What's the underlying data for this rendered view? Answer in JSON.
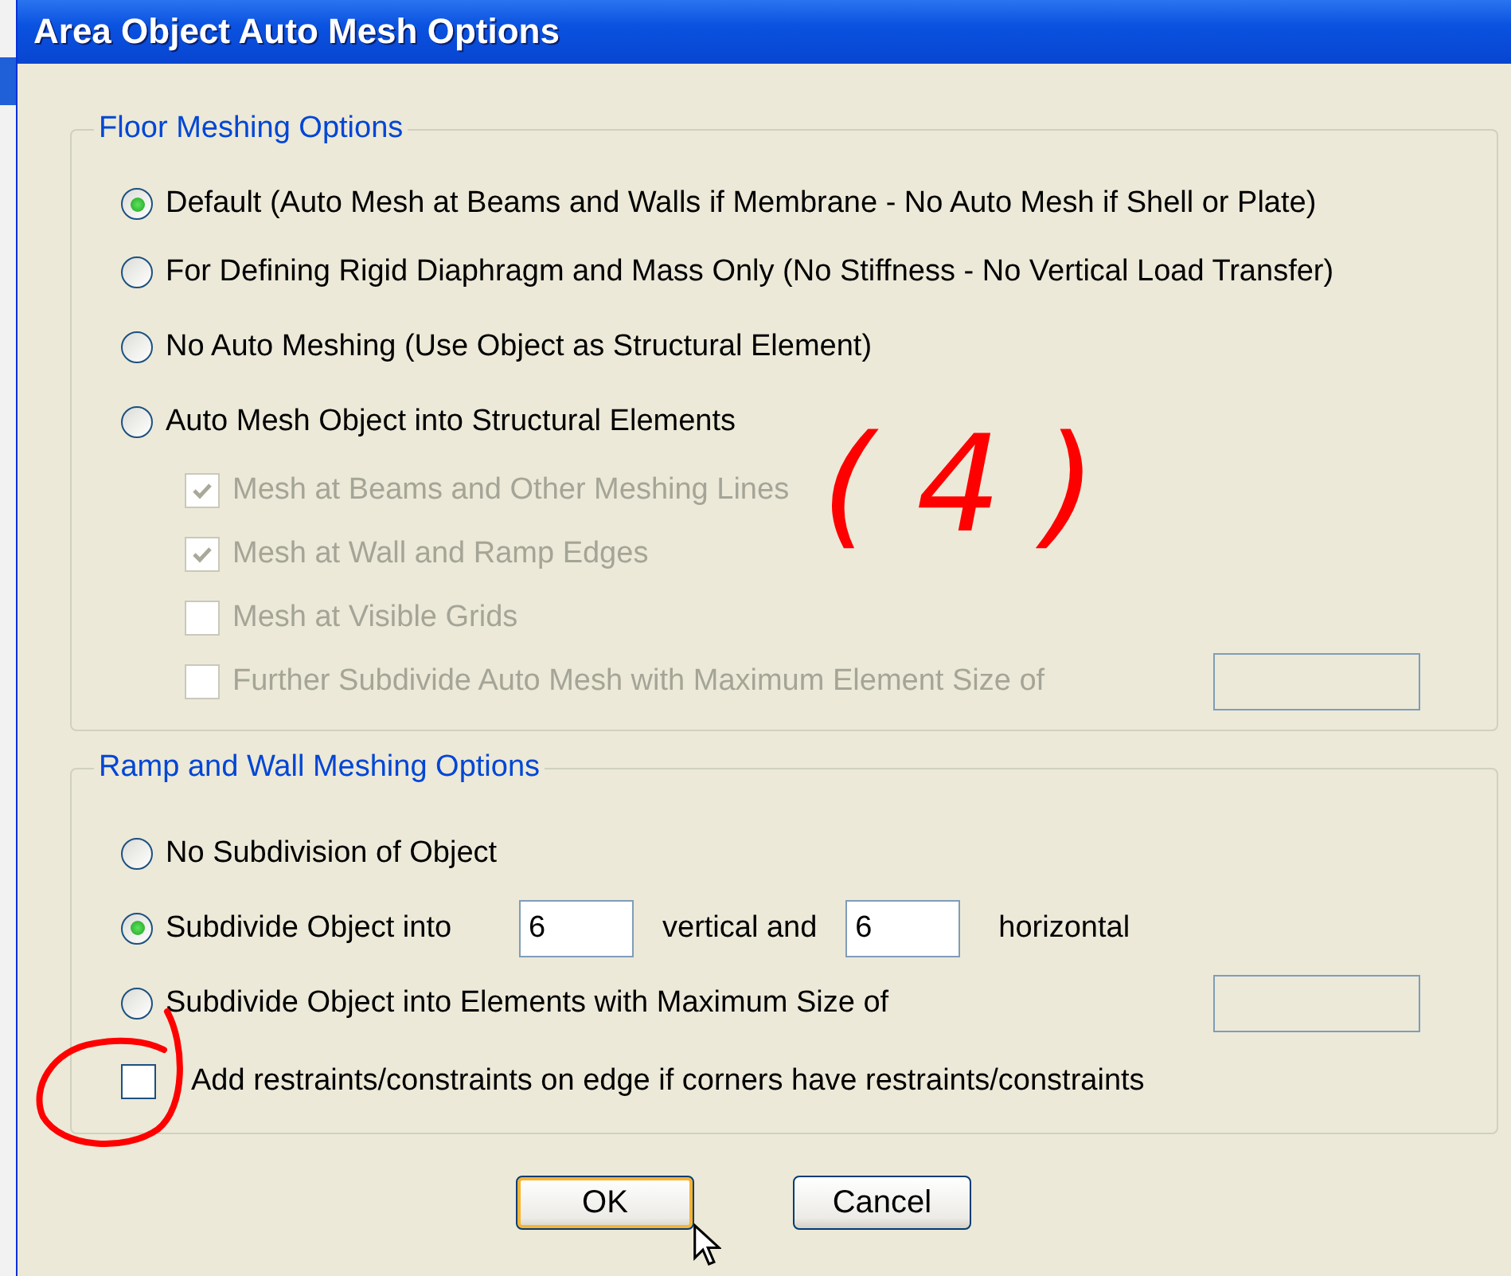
{
  "window": {
    "title": "Area Object Auto Mesh Options"
  },
  "floor_meshing": {
    "title": "Floor Meshing Options",
    "options": [
      {
        "label": "Default  (Auto Mesh at Beams and Walls if Membrane - No Auto Mesh if Shell or Plate)",
        "selected": true
      },
      {
        "label": "For Defining Rigid Diaphragm and Mass Only  (No Stiffness - No Vertical Load Transfer)",
        "selected": false
      },
      {
        "label": "No Auto Meshing  (Use Object as Structural Element)",
        "selected": false
      },
      {
        "label": "Auto Mesh Object into Structural Elements",
        "selected": false
      }
    ],
    "sub_options": [
      {
        "kind": "check",
        "label": "Mesh at Beams and Other Meshing Lines",
        "checked": true,
        "disabled": true
      },
      {
        "kind": "check",
        "label": "Mesh at Wall and Ramp Edges",
        "checked": true,
        "disabled": true
      },
      {
        "kind": "check",
        "label": "Mesh at Visible Grids",
        "checked": false,
        "disabled": true
      },
      {
        "kind": "check_field",
        "label": "Further Subdivide Auto Mesh with Maximum Element Size of",
        "checked": false,
        "disabled": true
      }
    ]
  },
  "ramp_wall_meshing": {
    "title": "Ramp and Wall Meshing Options",
    "options": [
      {
        "kind": "plain",
        "label": "No Subdivision of Object",
        "selected": false
      },
      {
        "kind": "grid",
        "label": "Subdivide Object into",
        "vertical": "6",
        "vertical_label": "vertical  and",
        "horizontal": "6",
        "horizontal_label": "horizontal",
        "selected": true
      },
      {
        "kind": "size",
        "label": "Subdivide Object into Elements with Maximum Size of",
        "selected": false
      }
    ]
  },
  "edge_option": {
    "label": "Add restraints/constraints on edge if corners have restraints/constraints",
    "checked": false
  },
  "annotation": {
    "text": "( 4 )"
  },
  "buttons": [
    {
      "label": "OK",
      "focused": true
    },
    {
      "label": "Cancel",
      "focused": false
    }
  ]
}
